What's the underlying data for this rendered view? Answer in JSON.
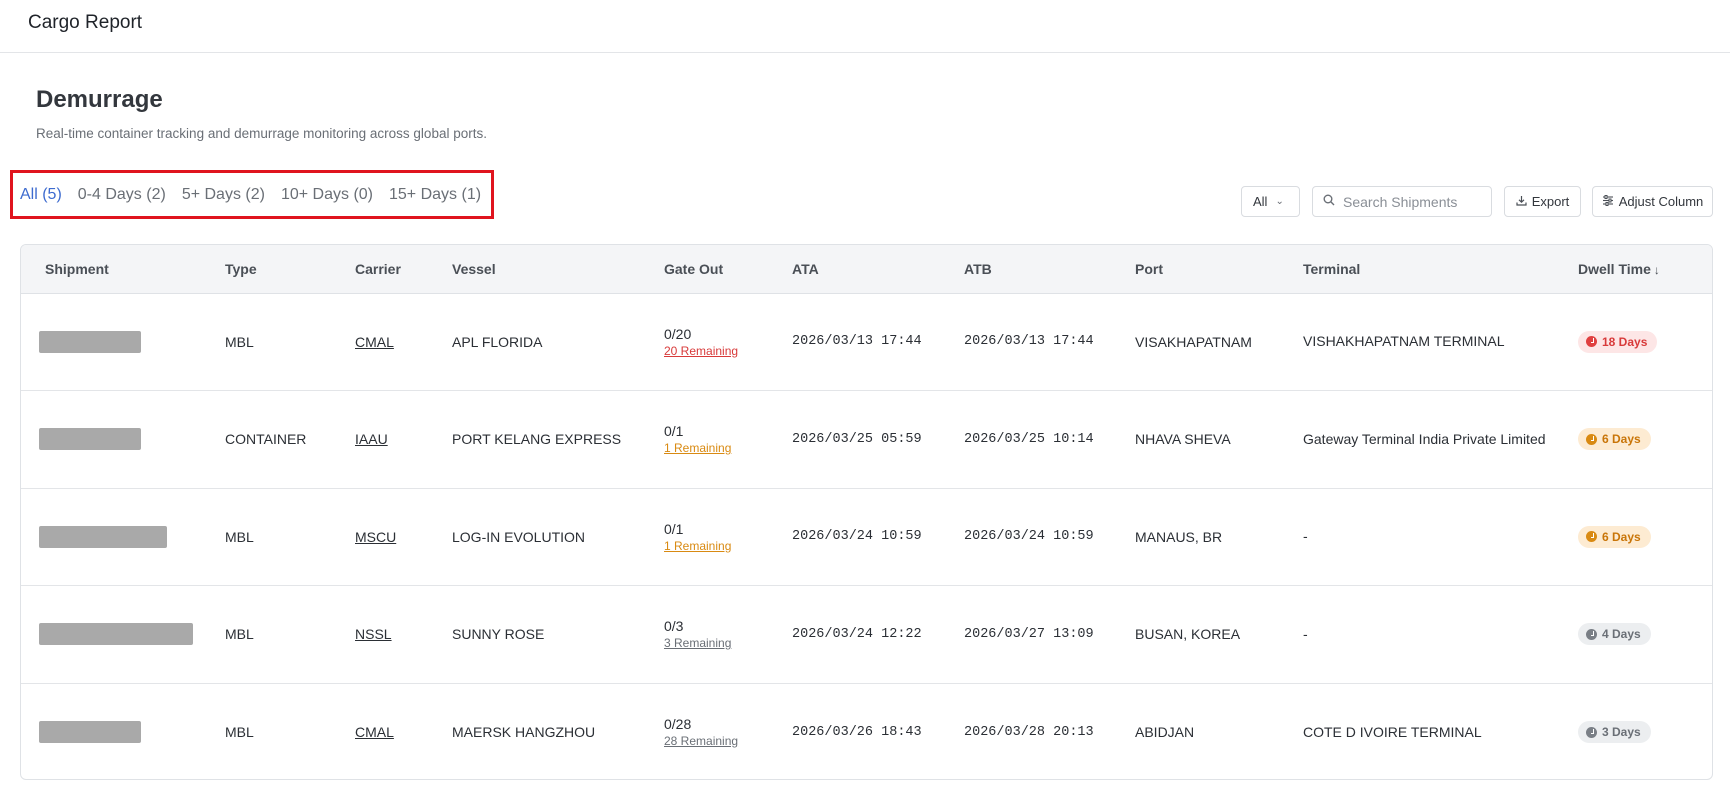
{
  "app": {
    "title": "Cargo Report"
  },
  "page": {
    "title": "Demurrage",
    "subtitle": "Real-time container tracking and demurrage monitoring across global ports."
  },
  "tabs": [
    {
      "label": "All (5)",
      "active": true
    },
    {
      "label": "0-4 Days (2)",
      "active": false
    },
    {
      "label": "5+ Days (2)",
      "active": false
    },
    {
      "label": "10+ Days (0)",
      "active": false
    },
    {
      "label": "15+ Days (1)",
      "active": false
    }
  ],
  "toolbar": {
    "filter_value": "All",
    "search_placeholder": "Search Shipments",
    "export_label": "Export",
    "adjust_label": "Adjust Column"
  },
  "table": {
    "columns": [
      "Shipment",
      "Type",
      "Carrier",
      "Vessel",
      "Gate Out",
      "ATA",
      "ATB",
      "Port",
      "Terminal",
      "Dwell Time"
    ],
    "sort_indicator": "↓",
    "rows": [
      {
        "type": "MBL",
        "carrier": "CMAL",
        "vessel": "APL FLORIDA",
        "gate_out": "0/20",
        "remaining": "20 Remaining",
        "ata": "2026/03/13 17:44",
        "atb": "2026/03/13 17:44",
        "port": "VISAKHAPATNAM",
        "terminal": "VISHAKHAPATNAM TERMINAL",
        "dwell": "18 Days",
        "status": "red"
      },
      {
        "type": "CONTAINER",
        "carrier": "IAAU",
        "vessel": "PORT KELANG EXPRESS",
        "gate_out": "0/1",
        "remaining": "1 Remaining",
        "ata": "2026/03/25 05:59",
        "atb": "2026/03/25 10:14",
        "port": "NHAVA SHEVA",
        "terminal": "Gateway Terminal India Private Limited",
        "dwell": "6 Days",
        "status": "orange"
      },
      {
        "type": "MBL",
        "carrier": "MSCU",
        "vessel": "LOG-IN EVOLUTION",
        "gate_out": "0/1",
        "remaining": "1 Remaining",
        "ata": "2026/03/24 10:59",
        "atb": "2026/03/24 10:59",
        "port": "MANAUS, BR",
        "terminal": "-",
        "dwell": "6 Days",
        "status": "orange"
      },
      {
        "type": "MBL",
        "carrier": "NSSL",
        "vessel": "SUNNY ROSE",
        "gate_out": "0/3",
        "remaining": "3 Remaining",
        "ata": "2026/03/24 12:22",
        "atb": "2026/03/27 13:09",
        "port": "BUSAN, KOREA",
        "terminal": "-",
        "dwell": "4 Days",
        "status": "gray"
      },
      {
        "type": "MBL",
        "carrier": "CMAL",
        "vessel": "MAERSK HANGZHOU",
        "gate_out": "0/28",
        "remaining": "28 Remaining",
        "ata": "2026/03/26 18:43",
        "atb": "2026/03/28 20:13",
        "port": "ABIDJAN",
        "terminal": "COTE D IVOIRE TERMINAL",
        "dwell": "3 Days",
        "status": "gray"
      }
    ]
  }
}
